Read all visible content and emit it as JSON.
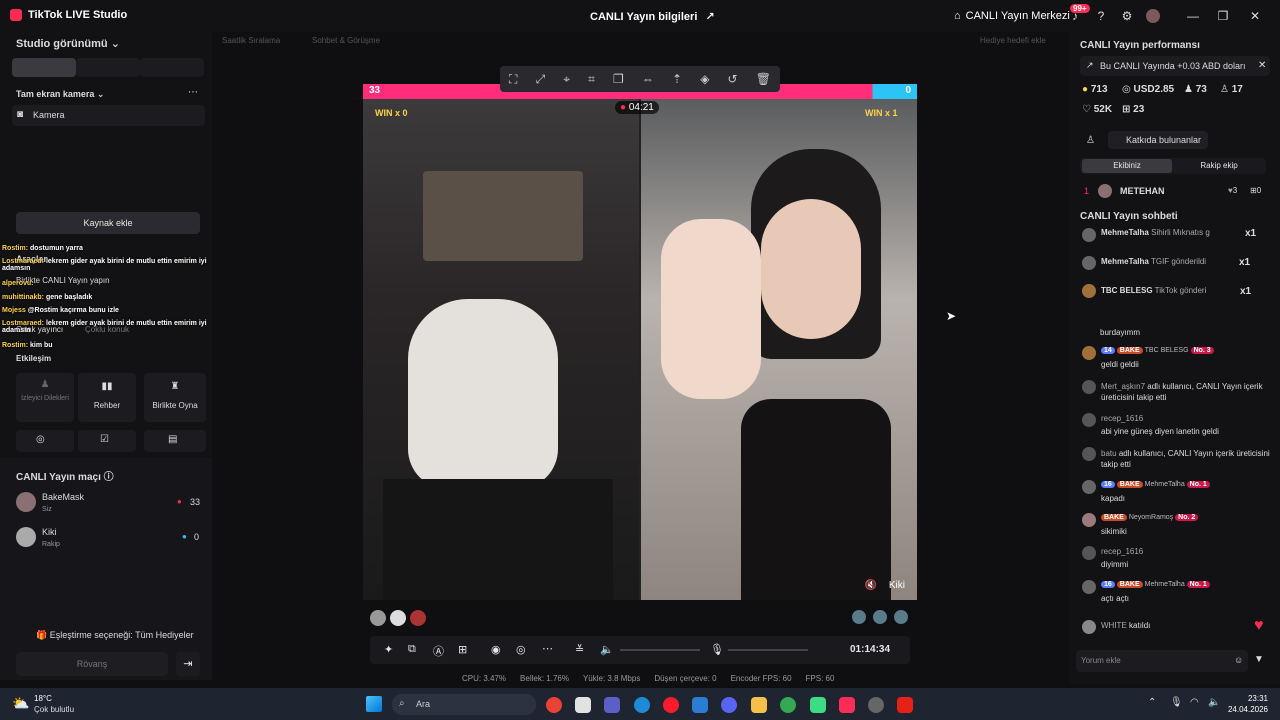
{
  "app": {
    "title": "TikTok LIVE Studio",
    "center_title": "CANLI Yayın bilgileri",
    "center_button": "CANLI Yayın Merkezi",
    "notification_count": "99+"
  },
  "left": {
    "view_label": "Studio görünümü",
    "camera_section": "Tam ekran kamera",
    "camera_item": "Kamera",
    "add_source": "Kaynak ekle",
    "tools_label": "Araçlar",
    "tools_items": [
      "Birlikte CANLI Yayın yapın",
      "Ortak yayıncı",
      "Çoklu konuk"
    ],
    "interaction_label": "Etkileşim",
    "interaction_items": [
      "İzleyici Dilekleri",
      "Rehber",
      "Birlikte Oyna"
    ],
    "overlay_chat": [
      {
        "name": "Rostim:",
        "text": "dostumun yarra"
      },
      {
        "name": "Lostmaraed:",
        "text": "lekrem gider ayak birini de mutlu ettin emirim iyi adamsın"
      },
      {
        "name": "alperovu:",
        "text": ""
      },
      {
        "name": "muhittinakb:",
        "text": "gene başladık"
      },
      {
        "name": "Mojess",
        "text": "@Rostim kaçırma bunu izle"
      },
      {
        "name": "Lostmaraed:",
        "text": "lekrem gider ayak birini de mutlu ettin emirim iyi adamsın"
      },
      {
        "name": "Rostim:",
        "text": "kim bu"
      }
    ],
    "match_title": "CANLI Yayın maçı",
    "players": [
      {
        "name": "BakeMask",
        "role": "Siz",
        "score": "33"
      },
      {
        "name": "Kiki",
        "role": "Rakip",
        "score": "0"
      }
    ],
    "match_option": "Eşleştirme seçeneği: Tüm Hediyeler",
    "rematch_button": "Rövanş"
  },
  "stage": {
    "top_tabs": [
      "Saatlik Sıralama",
      "Sohbet & Görüşme",
      "Hediye hedefi ekle"
    ],
    "left_score": "33",
    "right_score": "0",
    "timer": "04:21",
    "left_win": "WIN x 0",
    "right_win": "WIN x 1",
    "right_name": "Kiki",
    "elapsed": "01:14:34"
  },
  "stats": {
    "cpu": "CPU: 3.47%",
    "memory": "Bellek: 1.76%",
    "upload": "Yükle: 3.8 Mbps",
    "dropped": "Düşen çerçeve: 0",
    "encoder_fps": "Encoder FPS: 60",
    "fps": "FPS: 60"
  },
  "right": {
    "perf_title": "CANLI Yayın performansı",
    "earnings_note": "Bu CANLI Yayında +0.03 ABD doları",
    "metrics": [
      "713",
      "USD2.85",
      "73",
      "17",
      "52K",
      "23"
    ],
    "contributors_button": "Katkıda bulunanlar",
    "team_tabs": [
      "Ekibiniz",
      "Rakip ekip"
    ],
    "top_contributor": {
      "rank": "1",
      "name": "METEHAN",
      "hearts": "3",
      "score": "0"
    },
    "chat_title": "CANLI Yayın sohbeti",
    "gift_rows": [
      {
        "name": "MehmeTalha",
        "text": "Sihirli Mıknatıs g",
        "count": "x1"
      },
      {
        "name": "MehmeTalha",
        "text": "TGIF gönderildi",
        "count": "x1"
      },
      {
        "name": "TBC BELESG",
        "text": "TikTok gönderi",
        "count": "x1"
      }
    ],
    "messages": [
      {
        "user": "",
        "text": "burdayımm",
        "badges": []
      },
      {
        "user": "TBC BELESG",
        "text": "geldi geldii",
        "badges": [
          "14",
          "BAKE",
          "No. 3"
        ]
      },
      {
        "user": "Mert_aşkın7",
        "text": "adlı kullanıcı, CANLI Yayın içerik üreticisini takip etti",
        "badges": []
      },
      {
        "user": "recep_1616",
        "text": "abi yine güneş diyen lanetin geldi",
        "badges": []
      },
      {
        "user": "batu",
        "text": "adlı kullanıcı, CANLI Yayın içerik üreticisini takip etti",
        "badges": []
      },
      {
        "user": "MehmeTalha",
        "text": "kapadı",
        "badges": [
          "16",
          "BAKE",
          "No. 1"
        ]
      },
      {
        "user": "NeyomRamoş",
        "text": "sikimiki",
        "badges": [
          "BAKE",
          "No. 2"
        ]
      },
      {
        "user": "recep_1616",
        "text": "diyimmi",
        "badges": []
      },
      {
        "user": "MehmeTalha",
        "text": "açtı açtı",
        "badges": [
          "16",
          "BAKE",
          "No. 1"
        ]
      },
      {
        "user": "WHITE",
        "text": "katıldı",
        "badges": []
      }
    ],
    "comment_placeholder": "Yorum ekle"
  },
  "taskbar": {
    "weather_temp": "18°C",
    "weather_desc": "Çok bulutlu",
    "search_placeholder": "Ara",
    "time": "23:31",
    "date": "24.04.2026"
  },
  "colors": {
    "accent_pink": "#ff2d55",
    "accent_blue": "#2bc4f5",
    "panel_bg": "#121214"
  }
}
